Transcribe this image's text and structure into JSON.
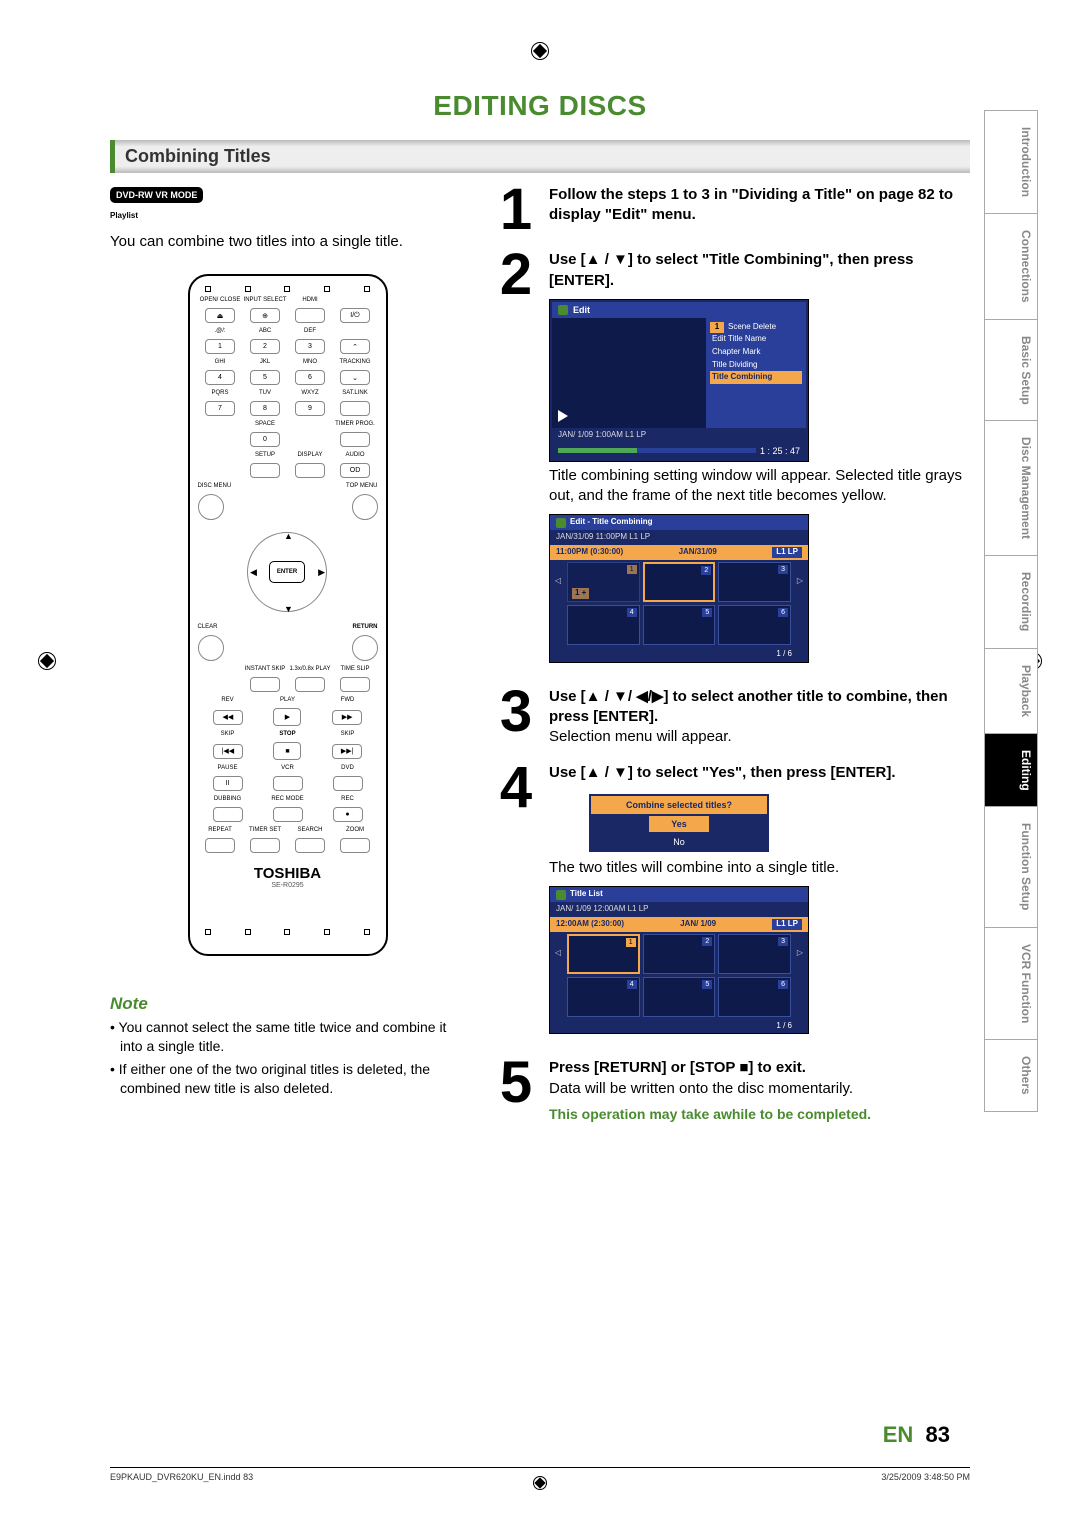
{
  "page_title": "EDITING DISCS",
  "section_title": "Combining Titles",
  "dvd_badge": "DVD-RW VR MODE",
  "playlist_label": "Playlist",
  "intro_text": "You can combine two titles into a single title.",
  "remote": {
    "brand": "TOSHIBA",
    "model": "SE-R0295",
    "labels": {
      "open_close": "OPEN/\nCLOSE",
      "input_select": "INPUT\nSELECT",
      "hdmi": "HDMI",
      "atsign": ".@/:",
      "abc": "ABC",
      "def": "DEF",
      "ghi": "GHI",
      "jkl": "JKL",
      "mno": "MNO",
      "tracking": "TRACKING",
      "pqrs": "PQRS",
      "tuv": "TUV",
      "wxyz": "WXYZ",
      "satlink": "SAT.LINK",
      "space": "SPACE",
      "timer_prog": "TIMER\nPROG.",
      "setup": "SETUP",
      "display": "DISPLAY",
      "audio": "AUDIO",
      "disc_menu": "DISC MENU",
      "top_menu": "TOP MENU",
      "enter": "ENTER",
      "clear": "CLEAR",
      "return": "RETURN",
      "instant_skip": "INSTANT\nSKIP",
      "play13": "1.3x/0.8x\nPLAY",
      "time_slip": "TIME SLIP",
      "rev": "REV",
      "play": "PLAY",
      "fwd": "FWD",
      "skip": "SKIP",
      "stop": "STOP",
      "pause": "PAUSE",
      "vcr": "VCR",
      "dvd": "DVD",
      "dubbing": "DUBBING",
      "rec_mode": "REC MODE",
      "rec": "REC",
      "repeat": "REPEAT",
      "timer_set": "TIMER SET",
      "search": "SEARCH",
      "zoom": "ZOOM"
    },
    "keys": {
      "k1": "1",
      "k2": "2",
      "k3": "3",
      "k4": "4",
      "k5": "5",
      "k6": "6",
      "k7": "7",
      "k8": "8",
      "k9": "9",
      "k0": "0"
    }
  },
  "steps": {
    "s1": "Follow the steps 1 to 3 in \"Dividing a Title\" on page 82 to display \"Edit\" menu.",
    "s2_title": "Use [▲ / ▼] to select \"Title Combining\", then press [ENTER].",
    "s2_desc": "Title combining setting window will appear. Selected title grays out, and the frame of the next title becomes yellow.",
    "s3_title": "Use [▲ / ▼/ ◀/▶] to select another title to combine, then press [ENTER].",
    "s3_desc": "Selection menu will appear.",
    "s4_title": "Use [▲ / ▼] to select \"Yes\", then press [ENTER].",
    "s4_desc": "The two titles will combine into a single title.",
    "s5_title": "Press [RETURN] or [STOP ■] to exit.",
    "s5_desc": "Data will be written onto the disc momentarily.",
    "s5_green": "This operation may take awhile to be completed."
  },
  "screen1": {
    "header": "Edit",
    "menu_num": "1",
    "menu_items": [
      "Scene Delete",
      "Edit Title Name",
      "Chapter Mark",
      "Title Dividing",
      "Title Combining"
    ],
    "selected_index": 4,
    "info": "JAN/ 1/09  1:00AM L1    LP",
    "time": "1 : 25 : 47"
  },
  "screen2": {
    "header": "Edit - Title Combining",
    "line1": "JAN/31/09  11:00PM   L1   LP",
    "line2a": "11:00PM (0:30:00)",
    "line2b": "JAN/31/09",
    "line2c": "L1 LP",
    "cells": [
      "1",
      "2",
      "3",
      "4",
      "5",
      "6"
    ],
    "selected": 0,
    "highlight": 1,
    "plus": "1 +",
    "footer": "1 / 6"
  },
  "dialog": {
    "question": "Combine selected titles?",
    "yes": "Yes",
    "no": "No"
  },
  "screen3": {
    "header": "Title List",
    "line1": "JAN/  1/09  12:00AM   L1   LP",
    "line2a": "12:00AM (2:30:00)",
    "line2b": "JAN/  1/09",
    "line2c": "L1 LP",
    "cells": [
      "1",
      "2",
      "3",
      "4",
      "5",
      "6"
    ],
    "selected": 0,
    "footer": "1 / 6"
  },
  "note": {
    "title": "Note",
    "items": [
      "You cannot select the same title twice and combine it into a single title.",
      "If either one of the two original titles is deleted, the combined new title is also deleted."
    ]
  },
  "side_tabs": [
    "Introduction",
    "Connections",
    "Basic Setup",
    "Disc Management",
    "Recording",
    "Playback",
    "Editing",
    "Function Setup",
    "VCR Function",
    "Others"
  ],
  "active_tab_index": 6,
  "page_lang": "EN",
  "page_number": "83",
  "footer_left": "E9PKAUD_DVR620KU_EN.indd   83",
  "footer_right": "3/25/2009   3:48:50 PM"
}
